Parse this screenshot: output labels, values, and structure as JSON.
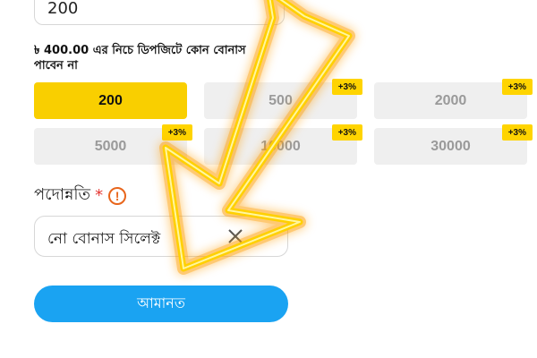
{
  "amount_input": {
    "value": "200"
  },
  "hint_text": "৳ 400.00 এর নিচে ডিপজিটে কোন বোনাস পাবেন না",
  "amount_options": [
    {
      "label": "200",
      "badge": "",
      "selected": true
    },
    {
      "label": "500",
      "badge": "+3%",
      "selected": false
    },
    {
      "label": "2000",
      "badge": "+3%",
      "selected": false
    },
    {
      "label": "5000",
      "badge": "+3%",
      "selected": false
    },
    {
      "label": "10000",
      "badge": "+3%",
      "selected": false
    },
    {
      "label": "30000",
      "badge": "+3%",
      "selected": false
    }
  ],
  "promotion": {
    "label": "পদোন্নতি",
    "required_mark": "*",
    "info_icon": "info-icon",
    "selected_value": "নো বোনাস সিলেক্ট"
  },
  "submit_label": "আমানত",
  "colors": {
    "selected_chip": "#f9cf00",
    "badge": "#ffd400",
    "submit": "#1aa3f2",
    "info": "#e8651b",
    "arrow_glow": "#ffd000"
  }
}
